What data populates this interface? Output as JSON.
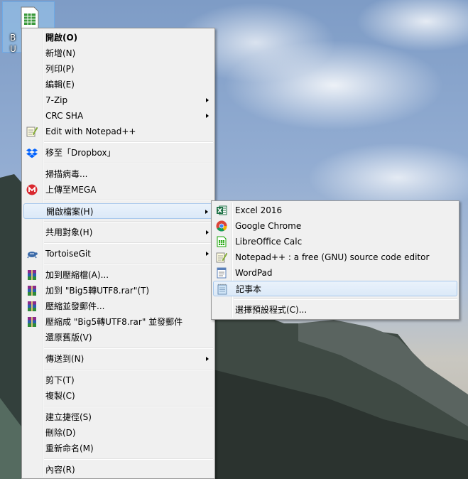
{
  "desktop": {
    "file_label": "B\nU"
  },
  "context_menu": {
    "items": [
      {
        "label": "開啟(O)"
      },
      {
        "label": "新增(N)"
      },
      {
        "label": "列印(P)"
      },
      {
        "label": "編輯(E)"
      },
      {
        "label": "7-Zip"
      },
      {
        "label": "CRC SHA"
      },
      {
        "label": "Edit with Notepad++"
      },
      {
        "label": "移至「Dropbox」"
      },
      {
        "label": "掃描病毒..."
      },
      {
        "label": "上傳至MEGA"
      },
      {
        "label": "開啟檔案(H)"
      },
      {
        "label": "共用對象(H)"
      },
      {
        "label": "TortoiseGit"
      },
      {
        "label": "加到壓縮檔(A)..."
      },
      {
        "label": "加到 \"Big5轉UTF8.rar\"(T)"
      },
      {
        "label": "壓縮並發郵件..."
      },
      {
        "label": "壓縮成 \"Big5轉UTF8.rar\" 並發郵件"
      },
      {
        "label": "還原舊版(V)"
      },
      {
        "label": "傳送到(N)"
      },
      {
        "label": "剪下(T)"
      },
      {
        "label": "複製(C)"
      },
      {
        "label": "建立捷徑(S)"
      },
      {
        "label": "刪除(D)"
      },
      {
        "label": "重新命名(M)"
      },
      {
        "label": "內容(R)"
      }
    ]
  },
  "submenu": {
    "items": [
      {
        "label": "Excel 2016"
      },
      {
        "label": "Google Chrome"
      },
      {
        "label": "LibreOffice Calc"
      },
      {
        "label": "Notepad++ : a free (GNU) source code editor"
      },
      {
        "label": "WordPad"
      },
      {
        "label": "記事本"
      },
      {
        "label": "選擇預設程式(C)..."
      }
    ]
  },
  "colors": {
    "menu_bg": "#f0f0f0",
    "highlight_border": "#a8c8ec",
    "excel_green": "#1e7145",
    "dropbox_blue": "#0061fe",
    "mega_red": "#d9272e"
  }
}
